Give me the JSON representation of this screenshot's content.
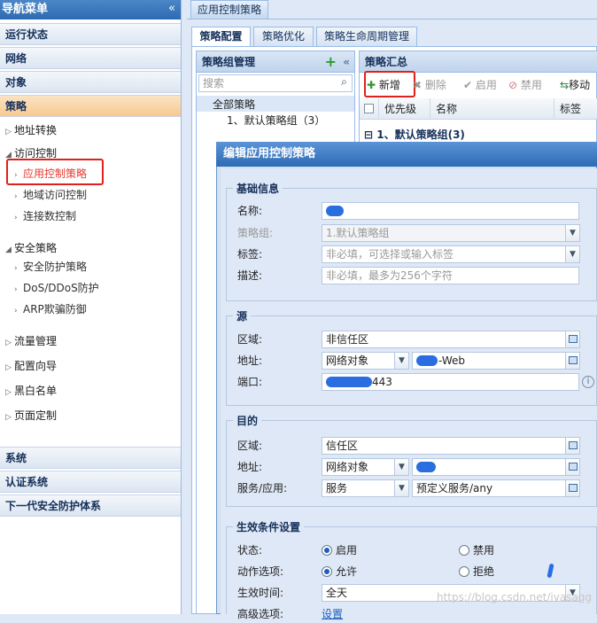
{
  "nav": {
    "title": "导航菜单",
    "collapse_icon": "«",
    "sections": [
      {
        "label": "运行状态"
      },
      {
        "label": "网络"
      },
      {
        "label": "对象"
      },
      {
        "label": "策略"
      }
    ],
    "policy_items": {
      "nat": "地址转换",
      "access_control": "访问控制",
      "app_control": "应用控制策略",
      "geo_access": "地域访问控制",
      "conn_control": "连接数控制",
      "security_policy": "安全策略",
      "security_protect": "安全防护策略",
      "dos": "DoS/DDoS防护",
      "arp": "ARP欺骗防御",
      "traffic": "流量管理",
      "wizard": "配置向导",
      "blackwhite": "黑白名单",
      "page_custom": "页面定制"
    },
    "bottom_sections": {
      "system": "系统",
      "auth": "认证系统",
      "ngfw": "下一代安全防护体系"
    }
  },
  "main_tab": "应用控制策略",
  "sub_tabs": [
    "策略配置",
    "策略优化",
    "策略生命周期管理"
  ],
  "group_panel": {
    "title": "策略组管理",
    "add_icon": "+",
    "collapse_icon": "«",
    "search_placeholder": "搜索",
    "tree_root": "全部策略",
    "tree_child": "1、默认策略组（3）"
  },
  "summary_panel": {
    "title": "策略汇总",
    "toolbar": {
      "add": "新增",
      "delete": "删除",
      "enable": "启用",
      "disable": "禁用",
      "move": "移动"
    },
    "columns": [
      "优先级",
      "名称",
      "标签"
    ],
    "group_row": "1、默认策略组(3)"
  },
  "dialog": {
    "title": "编辑应用控制策略",
    "basic": {
      "legend": "基础信息",
      "name_label": "名称:",
      "group_label": "策略组:",
      "group_value": "1.默认策略组",
      "tag_label": "标签:",
      "tag_placeholder": "非必填，可选择或输入标签",
      "desc_label": "描述:",
      "desc_placeholder": "非必填，最多为256个字符"
    },
    "source": {
      "legend": "源",
      "zone_label": "区域:",
      "zone_value": "非信任区",
      "addr_label": "地址:",
      "addr_type": "网络对象",
      "addr_value": "-Web",
      "port_label": "端口:",
      "port_value": "443"
    },
    "dest": {
      "legend": "目的",
      "zone_label": "区域:",
      "zone_value": "信任区",
      "addr_label": "地址:",
      "addr_type": "网络对象",
      "svc_label": "服务/应用:",
      "svc_type": "服务",
      "svc_value": "预定义服务/any"
    },
    "effect": {
      "legend": "生效条件设置",
      "status_label": "状态:",
      "enable": "启用",
      "disable": "禁用",
      "action_label": "动作选项:",
      "allow": "允许",
      "deny": "拒绝",
      "time_label": "生效时间:",
      "time_value": "全天",
      "adv_label": "高级选项:",
      "adv_value": "设置"
    }
  },
  "watermark": "https://blog.csdn.net/ivasagg"
}
